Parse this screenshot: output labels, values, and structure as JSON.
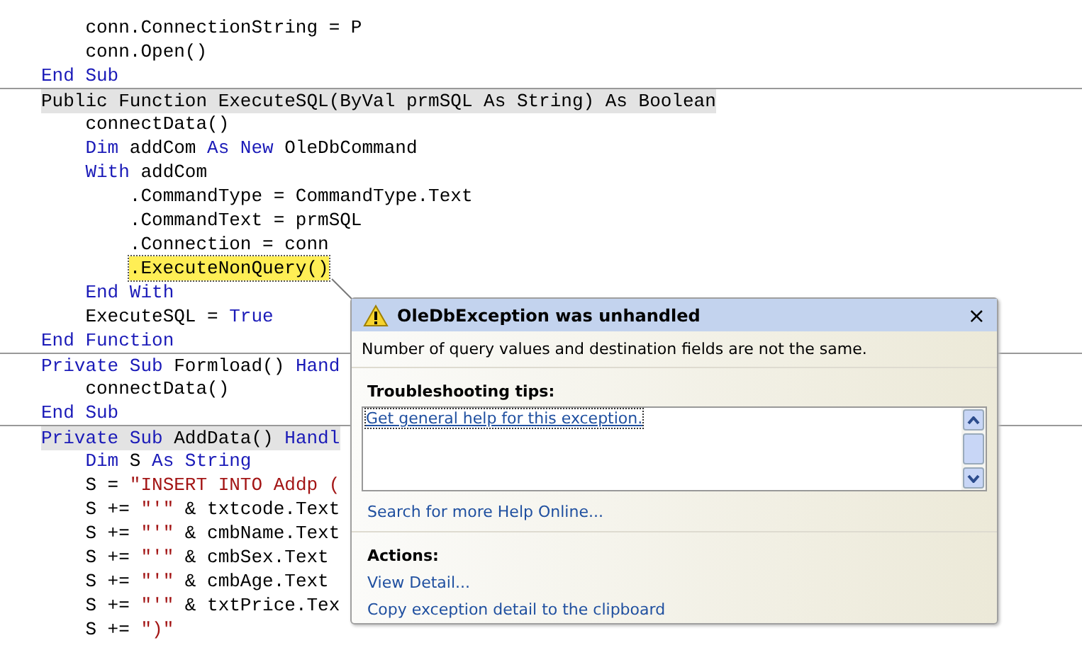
{
  "code_lines": [
    {
      "separator_before": false,
      "highlighted": false,
      "current": false,
      "tokens": [
        {
          "kind": "plain",
          "text": "    conn.ConnectionString = P"
        }
      ]
    },
    {
      "separator_before": false,
      "highlighted": false,
      "current": false,
      "tokens": [
        {
          "kind": "plain",
          "text": "    conn.Open()"
        }
      ]
    },
    {
      "separator_before": false,
      "highlighted": false,
      "current": false,
      "tokens": [
        {
          "kind": "keyword",
          "text": "End Sub"
        }
      ]
    },
    {
      "separator_before": true,
      "highlighted": true,
      "current": false,
      "tokens": [
        {
          "kind": "plain",
          "text": "Public Function ExecuteSQL(ByVal prmSQL As String) As Boolean"
        }
      ]
    },
    {
      "separator_before": false,
      "highlighted": false,
      "current": false,
      "tokens": [
        {
          "kind": "plain",
          "text": "    connectData()"
        }
      ]
    },
    {
      "separator_before": false,
      "highlighted": false,
      "current": false,
      "tokens": [
        {
          "kind": "keyword",
          "text": "    Dim"
        },
        {
          "kind": "plain",
          "text": " addCom "
        },
        {
          "kind": "keyword",
          "text": "As New"
        },
        {
          "kind": "plain",
          "text": " OleDbCommand"
        }
      ]
    },
    {
      "separator_before": false,
      "highlighted": false,
      "current": false,
      "tokens": [
        {
          "kind": "keyword",
          "text": "    With"
        },
        {
          "kind": "plain",
          "text": " addCom"
        }
      ]
    },
    {
      "separator_before": false,
      "highlighted": false,
      "current": false,
      "tokens": [
        {
          "kind": "plain",
          "text": "        .CommandType = CommandType.Text"
        }
      ]
    },
    {
      "separator_before": false,
      "highlighted": false,
      "current": false,
      "tokens": [
        {
          "kind": "plain",
          "text": "        .CommandText = prmSQL"
        }
      ]
    },
    {
      "separator_before": false,
      "highlighted": false,
      "current": false,
      "tokens": [
        {
          "kind": "plain",
          "text": "        .Connection = conn"
        }
      ]
    },
    {
      "separator_before": false,
      "highlighted": false,
      "current": true,
      "tokens": [
        {
          "kind": "plain",
          "text": ".ExecuteNonQuery()"
        }
      ]
    },
    {
      "separator_before": false,
      "highlighted": false,
      "current": false,
      "tokens": [
        {
          "kind": "keyword",
          "text": "    End With"
        }
      ]
    },
    {
      "separator_before": false,
      "highlighted": false,
      "current": false,
      "tokens": [
        {
          "kind": "plain",
          "text": "    ExecuteSQL = "
        },
        {
          "kind": "keyword",
          "text": "True"
        }
      ]
    },
    {
      "separator_before": false,
      "highlighted": false,
      "current": false,
      "tokens": [
        {
          "kind": "keyword",
          "text": "End Function"
        }
      ]
    },
    {
      "separator_before": true,
      "highlighted": false,
      "current": false,
      "tokens": [
        {
          "kind": "keyword",
          "text": "Private Sub"
        },
        {
          "kind": "plain",
          "text": " Formload() "
        },
        {
          "kind": "keyword",
          "text": "Hand"
        }
      ]
    },
    {
      "separator_before": false,
      "highlighted": false,
      "current": false,
      "tokens": [
        {
          "kind": "plain",
          "text": "    connectData()"
        }
      ]
    },
    {
      "separator_before": false,
      "highlighted": false,
      "current": false,
      "tokens": [
        {
          "kind": "keyword",
          "text": "End Sub"
        }
      ]
    },
    {
      "separator_before": true,
      "highlighted": true,
      "current": false,
      "tokens": [
        {
          "kind": "keyword",
          "text": "Private Sub"
        },
        {
          "kind": "plain",
          "text": " AddData() "
        },
        {
          "kind": "keyword",
          "text": "Handl"
        }
      ]
    },
    {
      "separator_before": false,
      "highlighted": false,
      "current": false,
      "tokens": [
        {
          "kind": "keyword",
          "text": "    Dim"
        },
        {
          "kind": "plain",
          "text": " S "
        },
        {
          "kind": "keyword",
          "text": "As String"
        }
      ]
    },
    {
      "separator_before": false,
      "highlighted": false,
      "current": false,
      "tokens": [
        {
          "kind": "plain",
          "text": "    S = "
        },
        {
          "kind": "string",
          "text": "\"INSERT INTO Addp ("
        }
      ]
    },
    {
      "separator_before": false,
      "highlighted": false,
      "current": false,
      "tokens": [
        {
          "kind": "plain",
          "text": "    S += "
        },
        {
          "kind": "string",
          "text": "\"'\""
        },
        {
          "kind": "plain",
          "text": " & txtcode.Text"
        }
      ]
    },
    {
      "separator_before": false,
      "highlighted": false,
      "current": false,
      "tokens": [
        {
          "kind": "plain",
          "text": "    S += "
        },
        {
          "kind": "string",
          "text": "\"'\""
        },
        {
          "kind": "plain",
          "text": " & cmbName.Text"
        }
      ]
    },
    {
      "separator_before": false,
      "highlighted": false,
      "current": false,
      "tokens": [
        {
          "kind": "plain",
          "text": "    S += "
        },
        {
          "kind": "string",
          "text": "\"'\""
        },
        {
          "kind": "plain",
          "text": " & cmbSex.Text"
        }
      ]
    },
    {
      "separator_before": false,
      "highlighted": false,
      "current": false,
      "tokens": [
        {
          "kind": "plain",
          "text": "    S += "
        },
        {
          "kind": "string",
          "text": "\"'\""
        },
        {
          "kind": "plain",
          "text": " & cmbAge.Text"
        }
      ]
    },
    {
      "separator_before": false,
      "highlighted": false,
      "current": false,
      "tokens": [
        {
          "kind": "plain",
          "text": "    S += "
        },
        {
          "kind": "string",
          "text": "\"'\""
        },
        {
          "kind": "plain",
          "text": " & txtPrice.Tex"
        }
      ]
    },
    {
      "separator_before": false,
      "highlighted": false,
      "current": false,
      "tokens": [
        {
          "kind": "plain",
          "text": "    S += "
        },
        {
          "kind": "string",
          "text": "\")\""
        }
      ]
    }
  ],
  "exception_popup": {
    "title": "OleDbException was unhandled",
    "close": "×",
    "message": "Number of query values and destination fields are not the same.",
    "tips_heading": "Troubleshooting tips:",
    "tips": [
      "Get general help for this exception."
    ],
    "search_link": "Search for more Help Online...",
    "actions_heading": "Actions:",
    "actions": [
      "View Detail...",
      "Copy exception detail to the clipboard"
    ]
  }
}
